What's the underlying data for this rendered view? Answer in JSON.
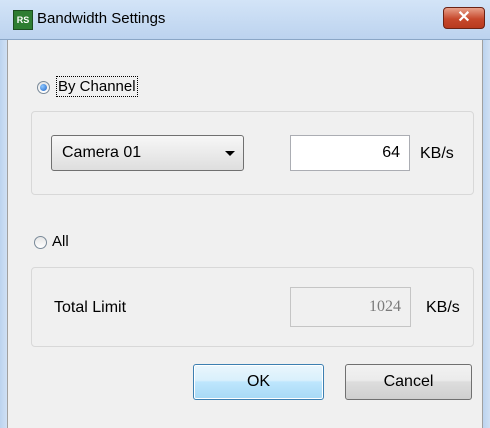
{
  "window": {
    "title": "Bandwidth Settings",
    "icon_text": "RS",
    "close_glyph": "✕"
  },
  "by_channel": {
    "label": "By Channel",
    "selected": true,
    "camera_select": {
      "value": "Camera 01"
    },
    "limit_value": "64",
    "unit": "KB/s"
  },
  "all": {
    "label": "All",
    "selected": false,
    "total_limit_label": "Total Limit",
    "total_limit_value": "1024",
    "unit": "KB/s"
  },
  "buttons": {
    "ok_label": "OK",
    "cancel_label": "Cancel"
  },
  "colors": {
    "close_button": "#c6482c",
    "default_button_border": "#3c7fb1",
    "radio_selected": "#1e63c7"
  }
}
